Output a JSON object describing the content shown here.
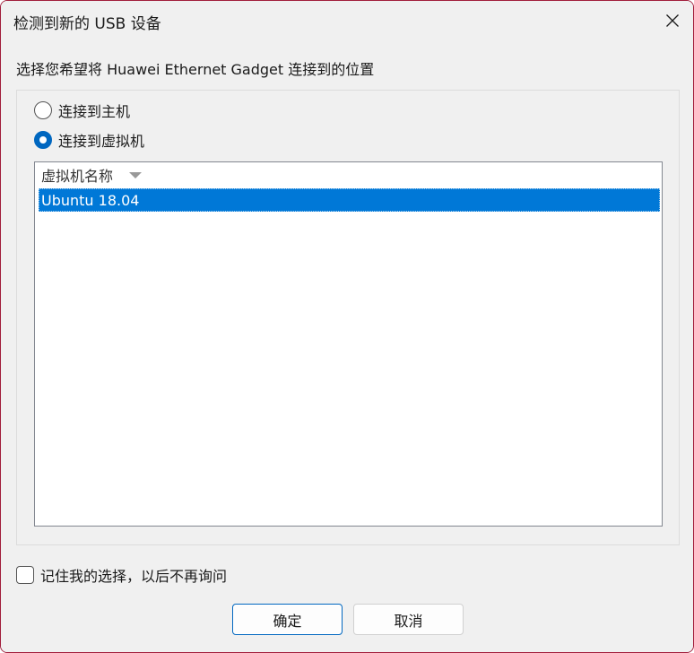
{
  "dialog": {
    "title": "检测到新的 USB 设备",
    "prompt": "选择您希望将 Huawei Ethernet Gadget 连接到的位置",
    "options": [
      {
        "label": "连接到主机",
        "selected": false
      },
      {
        "label": "连接到虚拟机",
        "selected": true
      }
    ],
    "list": {
      "column_header": "虚拟机名称",
      "rows": [
        "Ubuntu 18.04"
      ],
      "selected_index": 0
    },
    "remember": {
      "label": "记住我的选择，以后不再询问",
      "checked": false
    },
    "buttons": {
      "ok": "确定",
      "cancel": "取消"
    }
  },
  "colors": {
    "accent": "#0067c0",
    "selection": "#0078d7",
    "window_border": "#a11e3c"
  },
  "icons": {
    "close": "close-icon",
    "sort": "sort-arrow-icon"
  }
}
